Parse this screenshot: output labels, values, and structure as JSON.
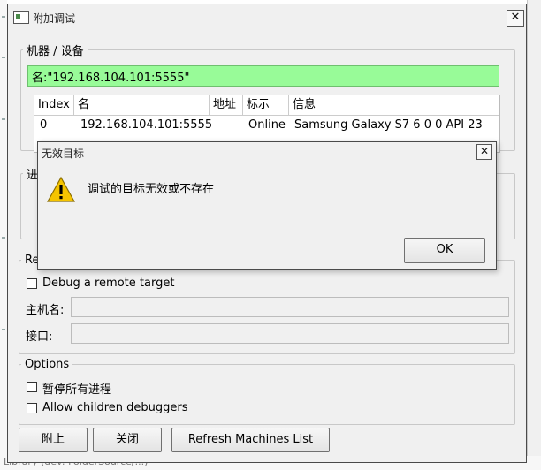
{
  "main_window": {
    "title": "附加调试",
    "close_glyph": "✕",
    "machines_group": {
      "label": "机器 / 设备",
      "filter_value": "名:\"192.168.104.101:5555\"",
      "table": {
        "columns": [
          "Index",
          "名",
          "地址",
          "标示",
          "信息"
        ],
        "rows": [
          {
            "index": "0",
            "name": "192.168.104.101:5555",
            "address": "",
            "status": "Online",
            "info": "Samsung Galaxy S7   6 0 0    API 23"
          }
        ]
      }
    },
    "partial_group_label": "进",
    "remote_group": {
      "label": "Re",
      "debug_remote_label": "Debug a remote target",
      "debug_remote_checked": false,
      "host_label": "主机名:",
      "host_value": "",
      "port_label": "接口:",
      "port_value": ""
    },
    "options_group": {
      "label": "Options",
      "pause_all_label": "暂停所有进程",
      "pause_all_checked": false,
      "allow_children_label": "Allow children debuggers",
      "allow_children_checked": false
    },
    "buttons": {
      "attach": "附上",
      "close": "关闭",
      "refresh": "Refresh Machines List"
    }
  },
  "error_dialog": {
    "title": "无效目标",
    "close_glyph": "✕",
    "message": "调试的目标无效或不存在",
    "ok_label": "OK",
    "icon": "warning-icon"
  },
  "background_text": "Library (dev: FolderSource/...)",
  "colors": {
    "filter_match_bg": "#98fb98",
    "warning_yellow": "#f5c400"
  }
}
